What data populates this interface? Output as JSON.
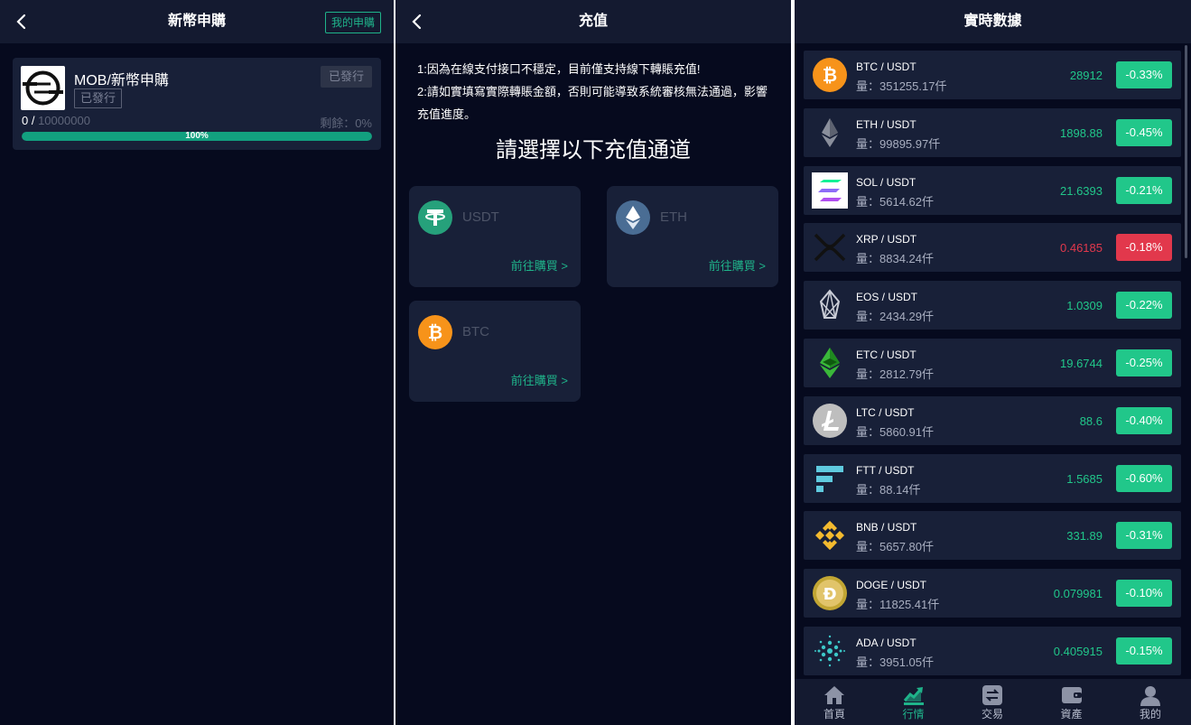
{
  "ipo": {
    "title": "新幣申購",
    "my_button": "我的申購",
    "coin_name": "MOB/新幣申購",
    "status_tag": "已發行",
    "status_button": "已發行",
    "progress_sold": "0 / ",
    "progress_total": "10000000",
    "remaining": "剩餘：0%",
    "progress_label": "100%",
    "progress_fraction": 1.0
  },
  "deposit": {
    "title": "充值",
    "notice_1": "1:因為在線支付接口不穩定，目前僅支持線下轉賬充值!",
    "notice_2": "2:請如實填寫實際轉賬金額，否則可能導致系統審核無法通過，影響充值進度。",
    "choose": "請選擇以下充值通道",
    "channels": [
      {
        "name": "USDT",
        "buy": "前往購買 >",
        "icon": "usdt-icon",
        "color": "#26a17b"
      },
      {
        "name": "ETH",
        "buy": "前往購買 >",
        "icon": "eth-icon",
        "color": "#4a6d94"
      },
      {
        "name": "BTC",
        "buy": "前往購買 >",
        "icon": "btc-icon",
        "color": "#f7931a"
      }
    ]
  },
  "market": {
    "title": "實時數據",
    "up_color": "#21c78a",
    "down_color": "#e2384c",
    "rows": [
      {
        "pair": "BTC / USDT",
        "vol": "量：351255.17仟",
        "price": "28912",
        "change": "-0.33%",
        "up": true,
        "icon": "btc-icon"
      },
      {
        "pair": "ETH / USDT",
        "vol": "量：99895.97仟",
        "price": "1898.88",
        "change": "-0.45%",
        "up": true,
        "icon": "eth-icon"
      },
      {
        "pair": "SOL / USDT",
        "vol": "量：5614.62仟",
        "price": "21.6393",
        "change": "-0.21%",
        "up": true,
        "icon": "sol-icon"
      },
      {
        "pair": "XRP / USDT",
        "vol": "量：8834.24仟",
        "price": "0.46185",
        "change": "-0.18%",
        "up": false,
        "icon": "xrp-icon"
      },
      {
        "pair": "EOS / USDT",
        "vol": "量：2434.29仟",
        "price": "1.0309",
        "change": "-0.22%",
        "up": true,
        "icon": "eos-icon"
      },
      {
        "pair": "ETC / USDT",
        "vol": "量：2812.79仟",
        "price": "19.6744",
        "change": "-0.25%",
        "up": true,
        "icon": "etc-icon"
      },
      {
        "pair": "LTC / USDT",
        "vol": "量：5860.91仟",
        "price": "88.6",
        "change": "-0.40%",
        "up": true,
        "icon": "ltc-icon"
      },
      {
        "pair": "FTT / USDT",
        "vol": "量：88.14仟",
        "price": "1.5685",
        "change": "-0.60%",
        "up": true,
        "icon": "ftt-icon"
      },
      {
        "pair": "BNB / USDT",
        "vol": "量：5657.80仟",
        "price": "331.89",
        "change": "-0.31%",
        "up": true,
        "icon": "bnb-icon"
      },
      {
        "pair": "DOGE / USDT",
        "vol": "量：11825.41仟",
        "price": "0.079981",
        "change": "-0.10%",
        "up": true,
        "icon": "doge-icon"
      },
      {
        "pair": "ADA / USDT",
        "vol": "量：3951.05仟",
        "price": "0.405915",
        "change": "-0.15%",
        "up": true,
        "icon": "ada-icon"
      }
    ],
    "tabs": [
      {
        "label": "首頁",
        "icon": "home-icon",
        "active": false
      },
      {
        "label": "行情",
        "icon": "chart-icon",
        "active": true
      },
      {
        "label": "交易",
        "icon": "exchange-icon",
        "active": false
      },
      {
        "label": "資產",
        "icon": "wallet-icon",
        "active": false
      },
      {
        "label": "我的",
        "icon": "user-icon",
        "active": false
      }
    ]
  }
}
